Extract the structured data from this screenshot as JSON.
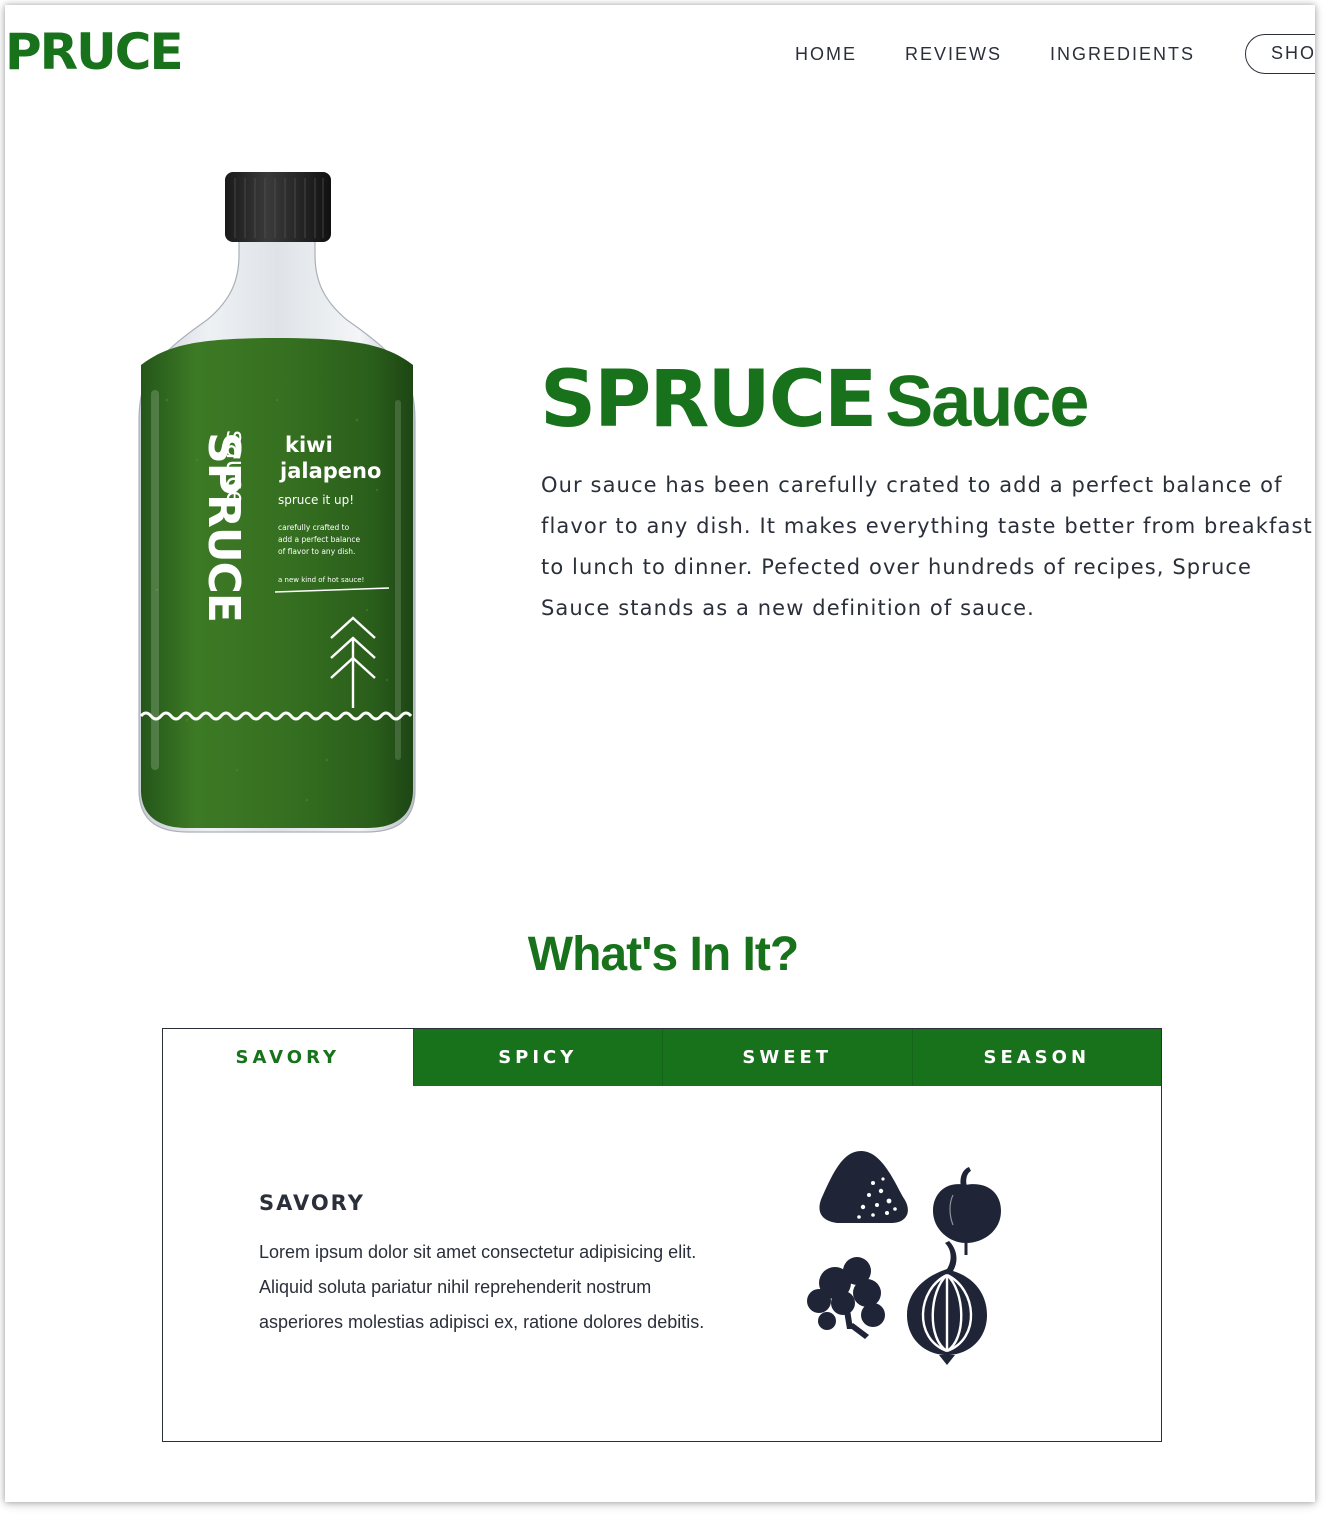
{
  "header": {
    "logo_text": "PRUCE",
    "nav": [
      {
        "label": "HOME"
      },
      {
        "label": "REVIEWS"
      },
      {
        "label": "INGREDIENTS"
      }
    ],
    "shop_label": "SHO"
  },
  "bottle": {
    "brand_text": "SPRUCE",
    "sauce_text": "sauce",
    "flavor_line1": "kiwi",
    "flavor_line2": "jalapeno",
    "tagline": "spruce it up!",
    "copy_line1": "carefully crafted to",
    "copy_line2": "add a perfect balance",
    "copy_line3": "of flavor to any dish.",
    "slogan": "a new kind of hot sauce!"
  },
  "hero": {
    "title_brand": "SPRUCE",
    "title_word": "Sauce",
    "description": "Our sauce has been carefully crated to add a perfect balance of flavor to any dish. It makes everything taste better from breakfast to lunch to dinner. Pefected over hundreds of recipes, Spruce Sauce stands as a new definition of sauce."
  },
  "section": {
    "title": "What's In It?"
  },
  "tabs": [
    {
      "label": "SAVORY",
      "active": true
    },
    {
      "label": "SPICY",
      "active": false
    },
    {
      "label": "SWEET",
      "active": false
    },
    {
      "label": "SEASON",
      "active": false
    }
  ],
  "panel": {
    "heading": "SAVORY",
    "text": "Lorem ipsum dolor sit amet consectetur adipisicing elit. Aliquid soluta pariatur nihil reprehenderit nostrum asperiores molestias adipisci ex, ratione dolores debitis.",
    "icons": [
      "salt-icon",
      "tomato-icon",
      "cilantro-icon",
      "onion-icon"
    ]
  },
  "colors": {
    "brand_green": "#17721b",
    "text_dark": "#2a2f3a",
    "icon_navy": "#1f2437"
  }
}
